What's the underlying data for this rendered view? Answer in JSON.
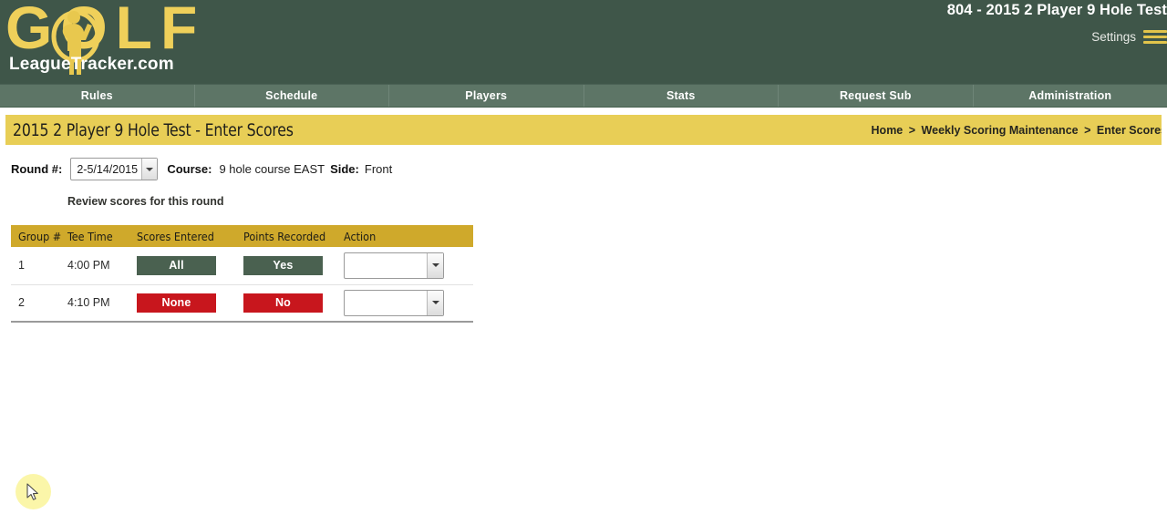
{
  "header": {
    "logo_main": "GOLF",
    "logo_sub": "LeagueTracker.com",
    "logo_icon": "golfer-silhouette-icon",
    "title": "804 - 2015 2 Player 9 Hole Test",
    "settings_label": "Settings",
    "menu_icon": "hamburger-menu-icon",
    "bg_color": "#3f5649"
  },
  "nav": {
    "bg_color": "#5d7566",
    "items": [
      {
        "label": "Rules"
      },
      {
        "label": "Schedule"
      },
      {
        "label": "Players"
      },
      {
        "label": "Stats"
      },
      {
        "label": "Request Sub"
      },
      {
        "label": "Administration"
      }
    ]
  },
  "page_title": {
    "text": "2015 2 Player 9 Hole Test - Enter Scores",
    "bg_color": "#e8ce56"
  },
  "breadcrumb": {
    "separator": ">",
    "items": [
      {
        "label": "Home"
      },
      {
        "label": "Weekly Scoring Maintenance"
      },
      {
        "label": "Enter Scores"
      }
    ]
  },
  "round_form": {
    "round_label": "Round #:",
    "round_value": "2-5/14/2015",
    "course_label": "Course:",
    "course_value": "9 hole course EAST",
    "side_label": "Side:",
    "side_value": "Front"
  },
  "review_link": {
    "label": "Review scores for this round"
  },
  "scores_table": {
    "columns": [
      {
        "label": "Group #"
      },
      {
        "label": "Tee Time"
      },
      {
        "label": "Scores Entered"
      },
      {
        "label": "Points Recorded"
      },
      {
        "label": "Action"
      }
    ],
    "header_bg": "#cfa92b",
    "rows": [
      {
        "group": "1",
        "tee_time": "4:00 PM",
        "scores_entered": "All",
        "scores_entered_state": "green",
        "points_recorded": "Yes",
        "points_recorded_state": "green",
        "action_value": ""
      },
      {
        "group": "2",
        "tee_time": "4:10 PM",
        "scores_entered": "None",
        "scores_entered_state": "red",
        "points_recorded": "No",
        "points_recorded_state": "red",
        "action_value": ""
      }
    ],
    "badge_green": "#4a6150",
    "badge_red": "#c8161d"
  },
  "cursor": {
    "icon": "mouse-pointer-icon"
  }
}
